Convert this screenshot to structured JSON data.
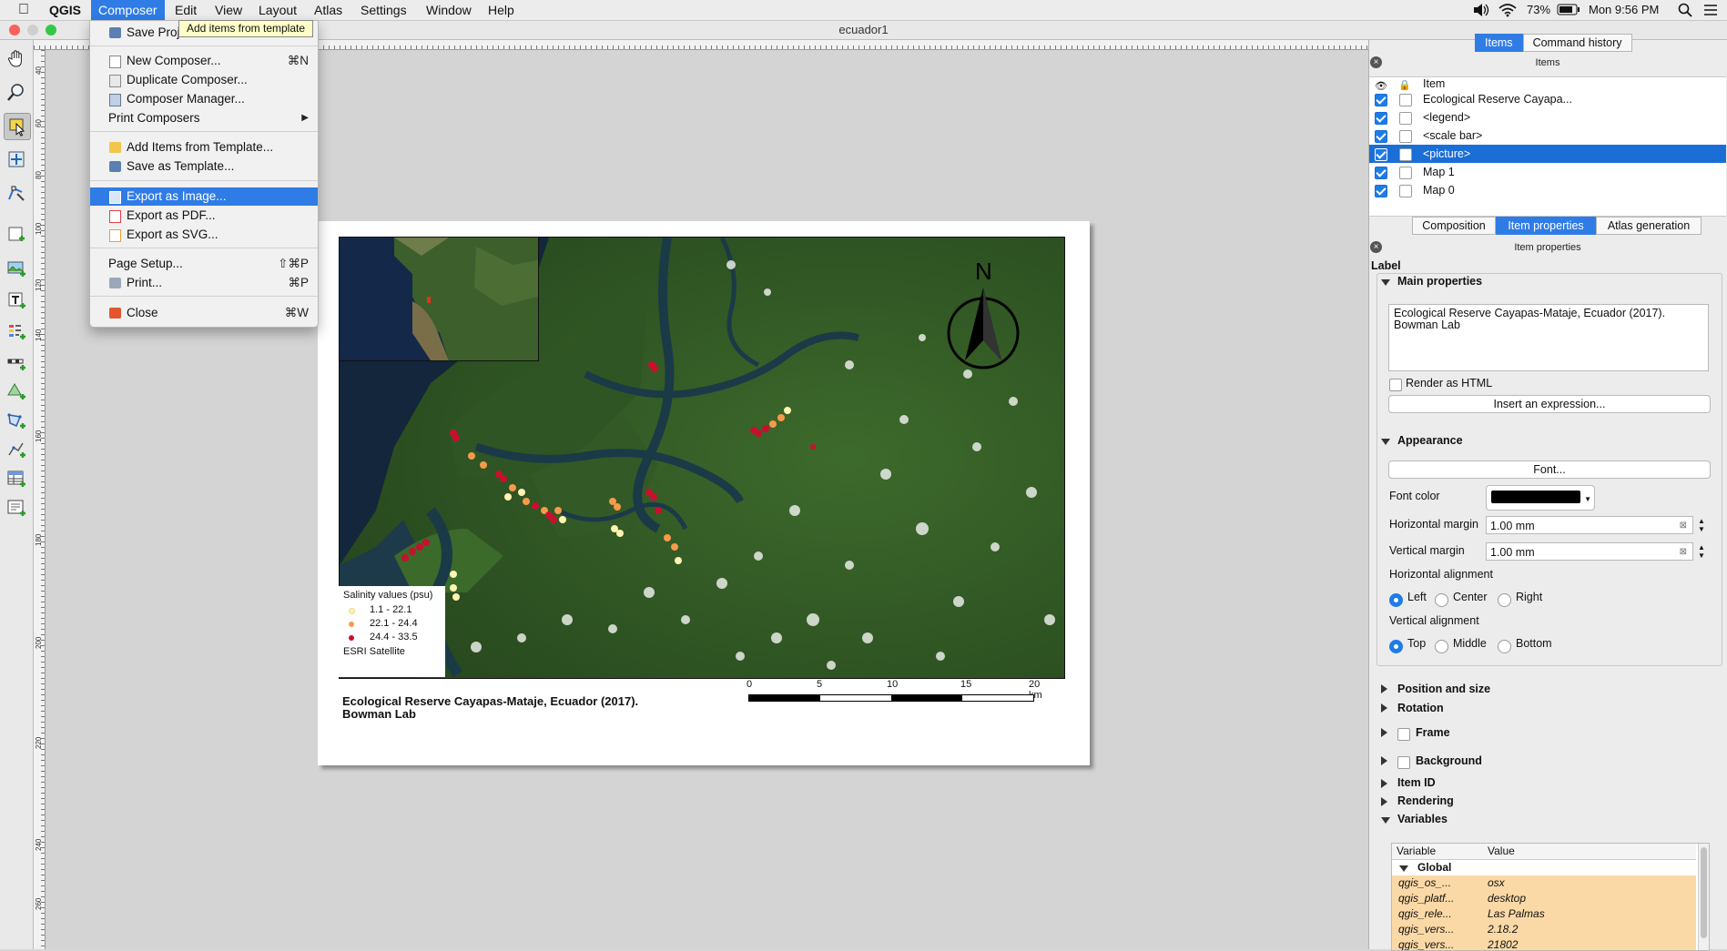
{
  "menubar": {
    "app": "QGIS",
    "items": [
      "Composer",
      "Edit",
      "View",
      "Layout",
      "Atlas",
      "Settings",
      "Window",
      "Help"
    ],
    "active": "Composer",
    "battery": "73%",
    "clock": "Mon 9:56 PM"
  },
  "window": {
    "title": "ecuador1"
  },
  "tooltip": "Add items from template",
  "dropdown": {
    "save_project": {
      "label": "Save Project",
      "shortcut": "⌘S"
    },
    "new_composer": {
      "label": "New Composer...",
      "shortcut": "⌘N"
    },
    "duplicate_composer": {
      "label": "Duplicate Composer..."
    },
    "composer_manager": {
      "label": "Composer Manager..."
    },
    "print_composers": {
      "label": "Print Composers",
      "arrow": "▶"
    },
    "add_items_from_template": {
      "label": "Add Items from Template..."
    },
    "save_as_template": {
      "label": "Save as Template..."
    },
    "export_image": {
      "label": "Export as Image..."
    },
    "export_pdf": {
      "label": "Export as PDF..."
    },
    "export_svg": {
      "label": "Export as SVG..."
    },
    "page_setup": {
      "label": "Page Setup...",
      "shortcut": "⇧⌘P"
    },
    "print": {
      "label": "Print...",
      "shortcut": "⌘P"
    },
    "close": {
      "label": "Close",
      "shortcut": "⌘W"
    }
  },
  "ruler_left_labels": [
    "40",
    "60",
    "80",
    "100",
    "120",
    "140",
    "160",
    "180",
    "200",
    "220",
    "240",
    "260"
  ],
  "map": {
    "north": "N",
    "legend_title": "Salinity values (psu)",
    "legend_items": [
      {
        "label": "1.1 - 22.1",
        "color": "#fff3b0"
      },
      {
        "label": "22.1 - 24.4",
        "color": "#f79a4a"
      },
      {
        "label": "24.4 - 33.5",
        "color": "#c8102e"
      }
    ],
    "legend_source": "ESRI Satellite",
    "label_line1": "Ecological Reserve Cayapas-Mataje, Ecuador (2017).",
    "label_line2": "Bowman Lab",
    "scale_ticks": [
      "0",
      "5",
      "10",
      "15",
      "20 km"
    ]
  },
  "right_panel": {
    "top_tabs": [
      "Items",
      "Command history"
    ],
    "items_title": "Items",
    "items_header": "Item",
    "items": [
      {
        "label": "Ecological Reserve Cayapa...",
        "visible": true,
        "locked": false,
        "selected": false
      },
      {
        "label": "<legend>",
        "visible": true,
        "locked": false,
        "selected": false
      },
      {
        "label": "<scale bar>",
        "visible": true,
        "locked": false,
        "selected": false
      },
      {
        "label": "<picture>",
        "visible": true,
        "locked": false,
        "selected": true
      },
      {
        "label": "Map 1",
        "visible": true,
        "locked": false,
        "selected": false
      },
      {
        "label": "Map 0",
        "visible": true,
        "locked": false,
        "selected": false
      }
    ],
    "mid_tabs": [
      "Composition",
      "Item properties",
      "Atlas generation"
    ],
    "mid_tab_selected": "Item properties",
    "item_props_title": "Item properties",
    "label_heading": "Label",
    "main_properties": "Main properties",
    "label_text_line1": "Ecological Reserve Cayapas-Mataje, Ecuador (2017).",
    "label_text_line2": "Bowman Lab",
    "render_html": "Render as HTML",
    "insert_expression": "Insert an expression...",
    "appearance": "Appearance",
    "font_button": "Font...",
    "font_color_label": "Font color",
    "font_color": "#000000",
    "hmargin_label": "Horizontal margin",
    "hmargin_value": "1.00 mm",
    "vmargin_label": "Vertical margin",
    "vmargin_value": "1.00 mm",
    "halign_label": "Horizontal alignment",
    "halign_options": [
      "Left",
      "Center",
      "Right"
    ],
    "valign_label": "Vertical alignment",
    "valign_options": [
      "Top",
      "Middle",
      "Bottom"
    ],
    "position_size": "Position and size",
    "rotation": "Rotation",
    "frame": "Frame",
    "background": "Background",
    "item_id": "Item ID",
    "rendering": "Rendering",
    "variables": "Variables",
    "var_headers": [
      "Variable",
      "Value"
    ],
    "var_group": "Global",
    "vars": [
      {
        "name": "qgis_os_...",
        "value": "osx"
      },
      {
        "name": "qgis_platf...",
        "value": "desktop"
      },
      {
        "name": "qgis_rele...",
        "value": "Las Palmas"
      },
      {
        "name": "qgis_vers...",
        "value": "2.18.2"
      },
      {
        "name": "qgis_vers...",
        "value": "21802"
      }
    ]
  },
  "colors": {
    "accent": "#2f7ce6",
    "selection": "#1b6ed6"
  }
}
